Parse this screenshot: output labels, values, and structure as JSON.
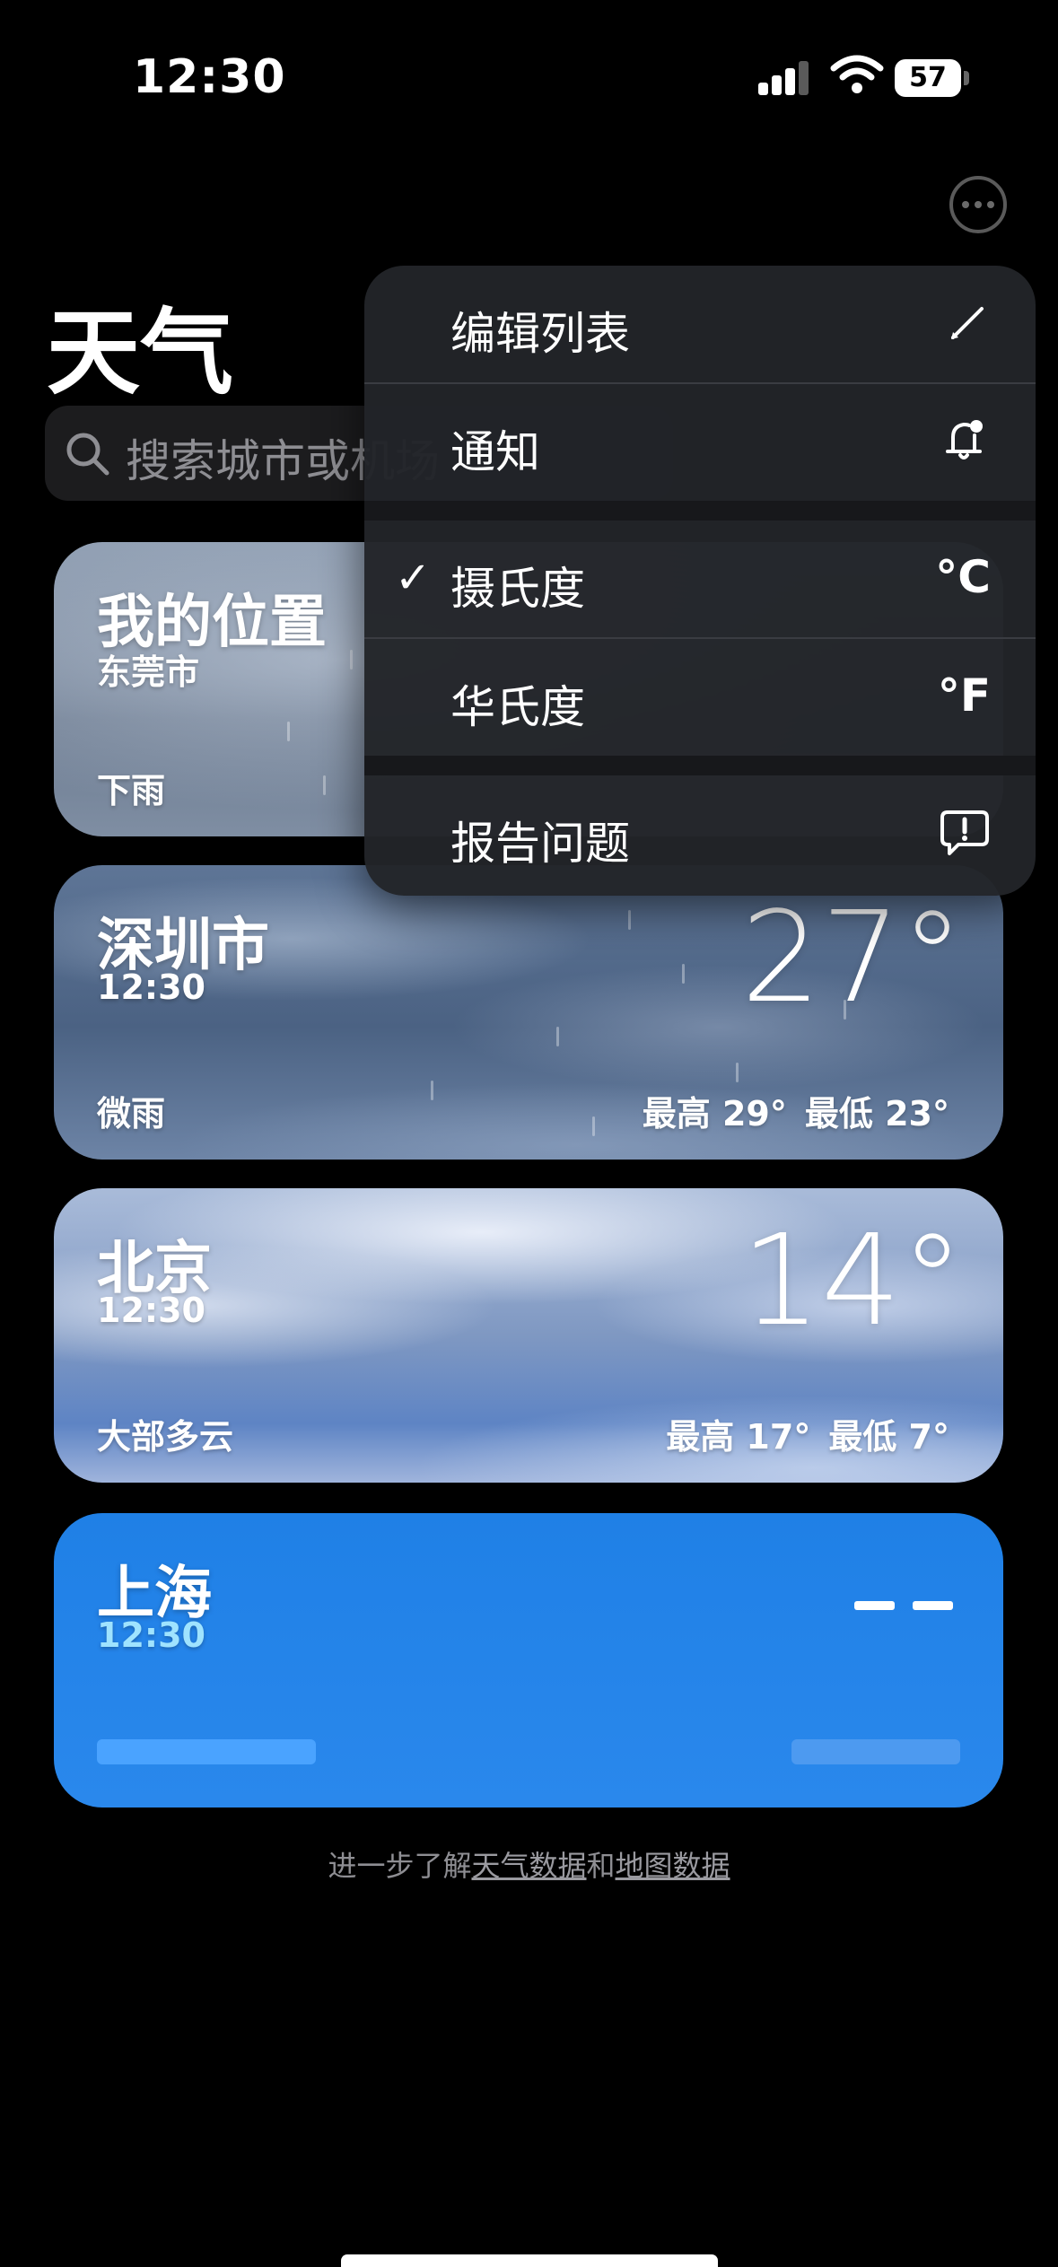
{
  "status_bar": {
    "time": "12:30",
    "battery": "57"
  },
  "header": {
    "title": "天气"
  },
  "search": {
    "placeholder": "搜索城市或机场"
  },
  "cards": [
    {
      "name": "我的位置",
      "sub": "东莞市",
      "condition": "下雨"
    },
    {
      "name": "深圳市",
      "sub": "12:30",
      "condition": "微雨",
      "temp": "27°",
      "high": "最高 29°",
      "low": "最低 23°"
    },
    {
      "name": "北京",
      "sub": "12:30",
      "condition": "大部多云",
      "temp": "14°",
      "high": "最高 17°",
      "low": "最低 7°"
    },
    {
      "name": "上海",
      "sub": "12:30"
    }
  ],
  "menu": {
    "edit_list": "编辑列表",
    "notifications": "通知",
    "celsius": "摄氏度",
    "celsius_unit": "°C",
    "fahrenheit": "华氏度",
    "fahrenheit_unit": "°F",
    "report": "报告问题",
    "selected_unit": "celsius"
  },
  "footer": {
    "prefix": "进一步了解",
    "link1": "天气数据",
    "mid": "和",
    "link2": "地图数据"
  }
}
